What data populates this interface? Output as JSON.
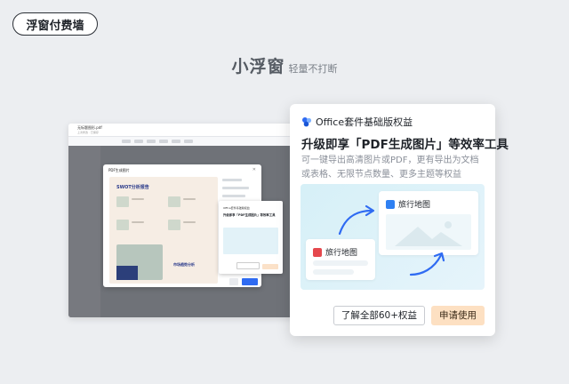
{
  "tag": {
    "label": "浮窗付费墙"
  },
  "hero": {
    "title": "小浮窗",
    "subtitle": "轻量不打断"
  },
  "app": {
    "file_name": "无标题图形.pdf",
    "file_sub": "上次修改 · 已保存",
    "dialog_title": "PDF生成图片",
    "preview_title": "SWOT分析报告",
    "preview_subtitle": "市场趋势分析"
  },
  "card": {
    "product": "Office套件基础版权益",
    "title": "升级即享「PDF生成图片」等效率工具",
    "description": "可一键导出高清图片或PDF，更有导出为文档或表格、无限节点数量、更多主题等权益",
    "illus_a": "旅行地图",
    "illus_b": "旅行地图",
    "btn_secondary": "了解全部60+权益",
    "btn_primary": "申请使用",
    "accent": "#fde0c2",
    "icon_colors": {
      "logo_blue": "#2f6bf2",
      "pdf_red": "#e5484d",
      "img_blue": "#2f80f2"
    }
  }
}
